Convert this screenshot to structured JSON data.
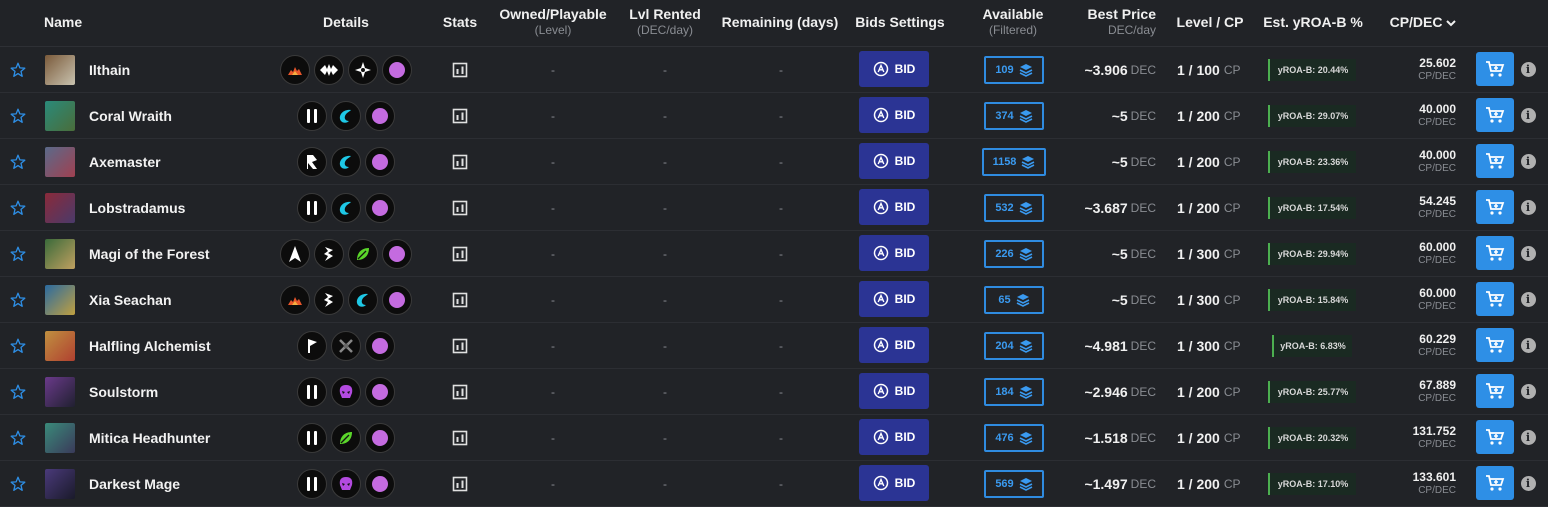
{
  "header": {
    "name": "Name",
    "details": "Details",
    "stats": "Stats",
    "owned": "Owned/Playable",
    "owned_sub": "(Level)",
    "lvl_rented": "Lvl Rented",
    "lvl_rented_sub": "(DEC/day)",
    "remaining": "Remaining (days)",
    "bids_settings": "Bids Settings",
    "available": "Available",
    "available_sub": "(Filtered)",
    "best_price": "Best Price",
    "best_price_sub": "DEC/day",
    "level_cp": "Level / CP",
    "yroa": "Est. yROA-B %",
    "cpdec": "CP/DEC",
    "sort_icon": "chevron-down-icon"
  },
  "labels": {
    "dash": "-",
    "bid": "BID",
    "dec": "DEC",
    "cp": "CP",
    "cpdec": "CP/DEC"
  },
  "colors": {
    "bid_button": "#2b3494",
    "cart_button": "#2e8fe6",
    "available_border": "#2f8be0",
    "yroa_accent": "#4caf50"
  },
  "rows": [
    {
      "name": "Ilthain",
      "thumb_colors": [
        "#7a5a3a",
        "#c9c3b0"
      ],
      "details": [
        "fire-element-icon",
        "blast-ability-icon",
        "sneak-ability-icon",
        "epic-rarity-icon"
      ],
      "available": "109",
      "price": "~3.906",
      "level": "1 / 100",
      "yroa": "yROA-B: 20.44%",
      "cp": "25.602"
    },
    {
      "name": "Coral Wraith",
      "thumb_colors": [
        "#2a8a7a",
        "#4a6d3a"
      ],
      "details": [
        "pause-ability-icon",
        "water-element-icon",
        "epic-rarity-icon"
      ],
      "available": "374",
      "price": "~5",
      "level": "1 / 200",
      "yroa": "yROA-B: 29.07%",
      "cp": "40.000"
    },
    {
      "name": "Axemaster",
      "thumb_colors": [
        "#5a6a8a",
        "#a04050"
      ],
      "details": [
        "double-strike-ability-icon",
        "water-element-icon",
        "epic-rarity-icon"
      ],
      "available": "1158",
      "price": "~5",
      "level": "1 / 200",
      "yroa": "yROA-B: 23.36%",
      "cp": "40.000"
    },
    {
      "name": "Lobstradamus",
      "thumb_colors": [
        "#8a2a3a",
        "#4a3a6a"
      ],
      "details": [
        "pause-ability-icon",
        "water-element-icon",
        "epic-rarity-icon"
      ],
      "available": "532",
      "price": "~3.687",
      "level": "1 / 200",
      "yroa": "yROA-B: 17.54%",
      "cp": "54.245"
    },
    {
      "name": "Magi of the Forest",
      "thumb_colors": [
        "#3a6a3a",
        "#c0a060"
      ],
      "details": [
        "piercing-ability-icon",
        "thorns-ability-icon",
        "earth-element-icon",
        "epic-rarity-icon"
      ],
      "available": "226",
      "price": "~5",
      "level": "1 / 300",
      "yroa": "yROA-B: 29.94%",
      "cp": "60.000"
    },
    {
      "name": "Xia Seachan",
      "thumb_colors": [
        "#2a6aa0",
        "#c0a040"
      ],
      "details": [
        "fire-element-icon",
        "thorns-ability-icon",
        "water-element-icon",
        "epic-rarity-icon"
      ],
      "available": "65",
      "price": "~5",
      "level": "1 / 300",
      "yroa": "yROA-B: 15.84%",
      "cp": "60.000"
    },
    {
      "name": "Halfling Alchemist",
      "thumb_colors": [
        "#c09040",
        "#b04030"
      ],
      "details": [
        "flag-ability-icon",
        "neutral-element-icon",
        "epic-rarity-icon"
      ],
      "available": "204",
      "price": "~4.981",
      "level": "1 / 300",
      "yroa": "yROA-B: 6.83%",
      "cp": "60.229"
    },
    {
      "name": "Soulstorm",
      "thumb_colors": [
        "#6a3a8a",
        "#202030"
      ],
      "details": [
        "pause-ability-icon",
        "death-element-icon",
        "epic-rarity-icon"
      ],
      "available": "184",
      "price": "~2.946",
      "level": "1 / 200",
      "yroa": "yROA-B: 25.77%",
      "cp": "67.889"
    },
    {
      "name": "Mitica Headhunter",
      "thumb_colors": [
        "#3a8a7a",
        "#3a3a5a"
      ],
      "details": [
        "pause-ability-icon",
        "earth-element-icon",
        "epic-rarity-icon"
      ],
      "available": "476",
      "price": "~1.518",
      "level": "1 / 200",
      "yroa": "yROA-B: 20.32%",
      "cp": "131.752"
    },
    {
      "name": "Darkest Mage",
      "thumb_colors": [
        "#4a3a7a",
        "#1a1a2a"
      ],
      "details": [
        "pause-ability-icon",
        "death-element-icon",
        "epic-rarity-icon"
      ],
      "available": "569",
      "price": "~1.497",
      "level": "1 / 200",
      "yroa": "yROA-B: 17.10%",
      "cp": "133.601"
    }
  ]
}
